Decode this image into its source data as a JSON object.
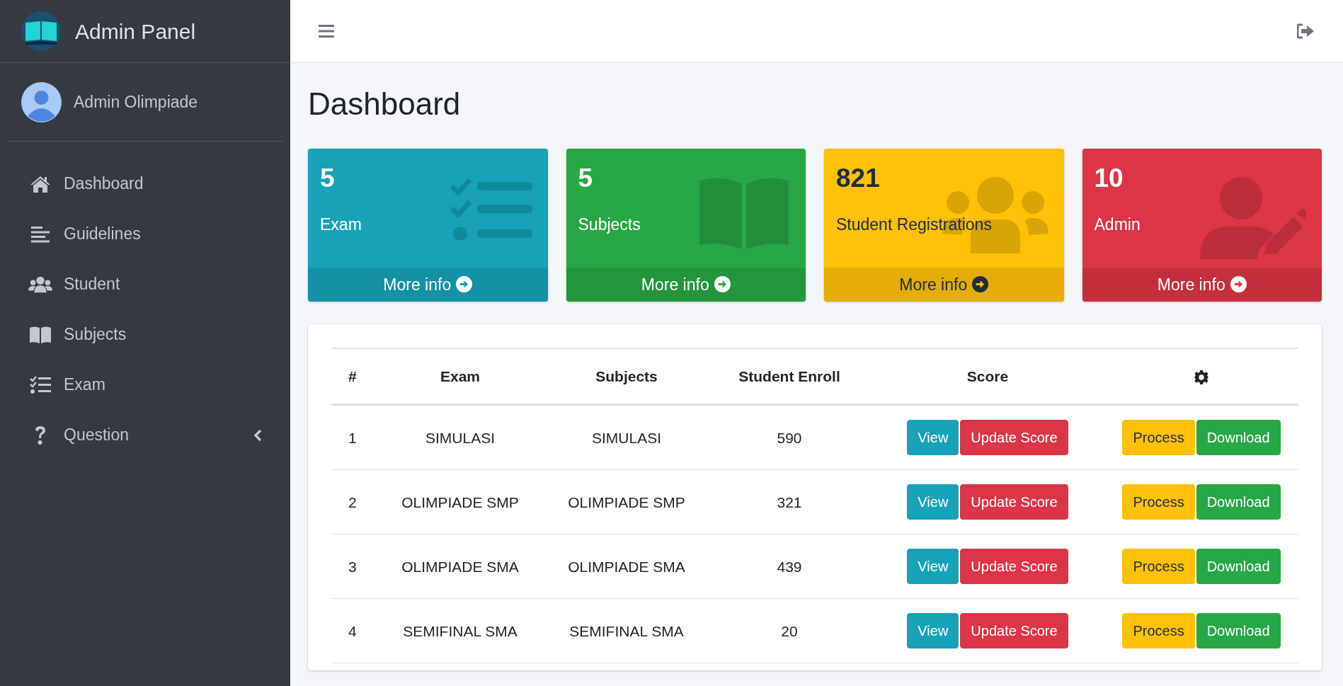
{
  "brand": {
    "title": "Admin Panel"
  },
  "user": {
    "name": "Admin Olimpiade"
  },
  "sidebar": {
    "items": [
      {
        "label": "Dashboard",
        "has_submenu": false
      },
      {
        "label": "Guidelines",
        "has_submenu": false
      },
      {
        "label": "Student",
        "has_submenu": false
      },
      {
        "label": "Subjects",
        "has_submenu": false
      },
      {
        "label": "Exam",
        "has_submenu": false
      },
      {
        "label": "Question",
        "has_submenu": true
      }
    ]
  },
  "page_title": "Dashboard",
  "cards": [
    {
      "value": "5",
      "label": "Exam",
      "link": "More info",
      "color": "#17a2b8"
    },
    {
      "value": "5",
      "label": "Subjects",
      "link": "More info",
      "color": "#28a745"
    },
    {
      "value": "821",
      "label": "Student Registrations",
      "link": "More info",
      "color": "#ffc107"
    },
    {
      "value": "10",
      "label": "Admin",
      "link": "More info",
      "color": "#dc3545"
    }
  ],
  "table": {
    "columns": [
      "#",
      "Exam",
      "Subjects",
      "Student Enroll",
      "Score"
    ],
    "rows": [
      {
        "cells": [
          "1",
          "SIMULASI",
          "SIMULASI",
          "590"
        ],
        "actions": [
          "View",
          "Update Score",
          "Process",
          "Download"
        ]
      },
      {
        "cells": [
          "2",
          "OLIMPIADE SMP",
          "OLIMPIADE SMP",
          "321"
        ],
        "actions": [
          "View",
          "Update Score",
          "Process",
          "Download"
        ]
      },
      {
        "cells": [
          "3",
          "OLIMPIADE SMA",
          "OLIMPIADE SMA",
          "439"
        ],
        "actions": [
          "View",
          "Update Score",
          "Process",
          "Download"
        ]
      },
      {
        "cells": [
          "4",
          "SEMIFINAL SMA",
          "SEMIFINAL SMA",
          "20"
        ],
        "actions": [
          "View",
          "Update Score",
          "Process",
          "Download"
        ]
      }
    ]
  }
}
